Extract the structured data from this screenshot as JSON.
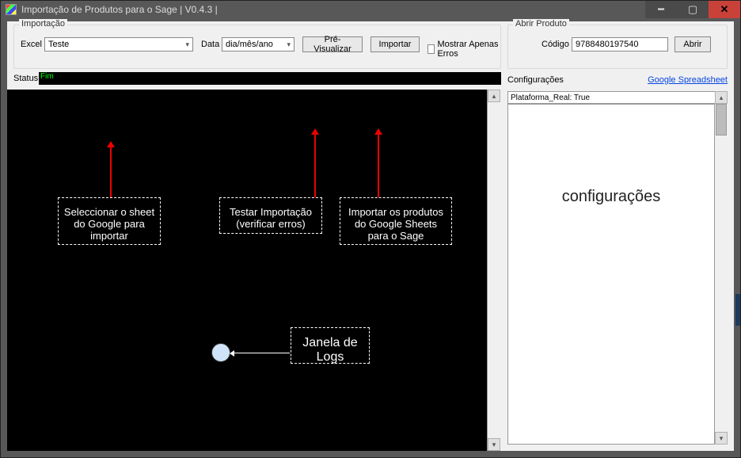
{
  "titlebar": {
    "title": "Importação de Produtos para o Sage | V0.4.3 |"
  },
  "import_group": {
    "legend": "Importação",
    "excel_label": "Excel",
    "excel_value": "Teste",
    "data_label": "Data",
    "data_value": "dia/mês/ano",
    "preview_btn": "Pré-Visualizar",
    "import_btn": "Importar",
    "show_errors_label": "Mostrar Apenas Erros"
  },
  "status": {
    "label": "Status",
    "value": "Fim"
  },
  "open_product": {
    "legend": "Abrir Produto",
    "code_label": "Código",
    "code_value": "9788480197540",
    "open_btn": "Abrir"
  },
  "config": {
    "label": "Configurações",
    "link": "Google Spreadsheet",
    "platform_line": "Plataforma_Real: True",
    "placeholder": "configurações"
  },
  "annotations": {
    "a1": "Seleccionar o sheet do Google para importar",
    "a2": "Testar Importação (verificar erros)",
    "a3": "Importar os produtos do Google Sheets para o Sage",
    "a4": "Janela de Logs"
  }
}
